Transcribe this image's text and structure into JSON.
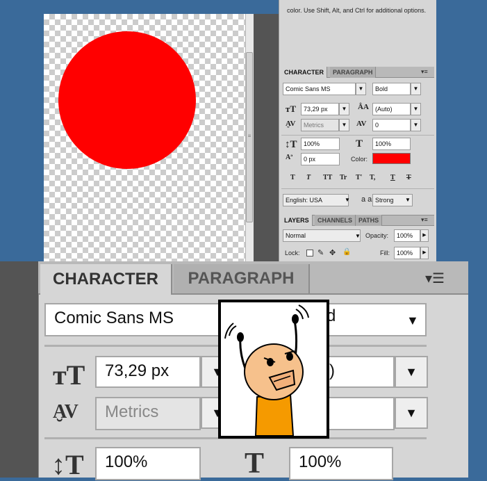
{
  "top_help_text": "color. Use Shift, Alt, and Ctrl for additional options.",
  "character_panel": {
    "tabs": [
      {
        "label": "CHARACTER"
      },
      {
        "label": "PARAGRAPH"
      }
    ],
    "font_family": "Comic Sans MS",
    "font_style": "Bold",
    "font_size": "73,29 px",
    "leading": "(Auto)",
    "kerning": "Metrics",
    "tracking": "0",
    "vertical_scale": "100%",
    "horizontal_scale": "100%",
    "baseline_shift": "0 px",
    "color_label": "Color:",
    "color_value": "#ff0000",
    "language": "English: USA",
    "anti_alias_icon_label": "a a",
    "anti_alias": "Strong",
    "format_buttons": [
      "T",
      "T",
      "TT",
      "Tr",
      "T'",
      "T,",
      "T",
      "T"
    ]
  },
  "layers_panel": {
    "tabs": [
      {
        "label": "LAYERS"
      },
      {
        "label": "CHANNELS"
      },
      {
        "label": "PATHS"
      }
    ],
    "blend_mode": "Normal",
    "opacity_label": "Opacity:",
    "opacity": "100%",
    "lock_label": "Lock:",
    "fill_label": "Fill:",
    "fill": "100%"
  },
  "zoomed_panel": {
    "tabs": [
      {
        "label": "CHARACTER"
      },
      {
        "label": "PARAGRAPH"
      }
    ],
    "font_family": "Comic Sans MS",
    "font_style_partial": "d",
    "font_size": "73,29 px",
    "leading_partial": "to)",
    "kerning": "Metrics",
    "vertical_scale": "100%",
    "horizontal_scale": "100%"
  },
  "colors": {
    "desktop_blue": "#3a6a9a",
    "panel_grey": "#d6d6d6",
    "circle_red": "#ff0000",
    "comic_skin": "#f6c18c",
    "comic_shirt": "#f59a00"
  }
}
